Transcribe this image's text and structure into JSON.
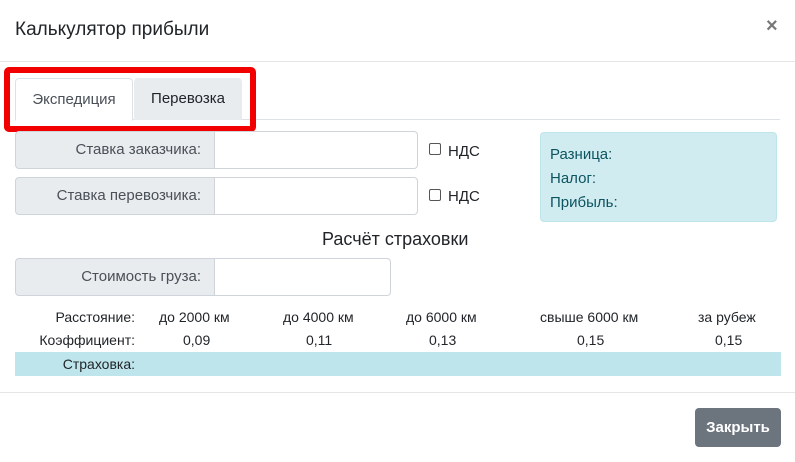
{
  "header": {
    "title": "Калькулятор прибыли",
    "close_icon": "×"
  },
  "tabs": [
    {
      "label": "Экспедиция",
      "active": true
    },
    {
      "label": "Перевозка",
      "active": false
    }
  ],
  "form": {
    "customer_rate_label": "Ставка заказчика:",
    "customer_rate_value": "",
    "carrier_rate_label": "Ставка перевозчика:",
    "carrier_rate_value": "",
    "vat_label": "НДС",
    "vat_customer_checked": false,
    "vat_carrier_checked": false,
    "cargo_value_label": "Стоимость груза:",
    "cargo_value_value": ""
  },
  "results": {
    "difference": "Разница:",
    "tax": "Налог:",
    "profit": "Прибыль:"
  },
  "insurance": {
    "title": "Расчёт страховки",
    "distance_label": "Расстояние:",
    "coef_label": "Коэффициент:",
    "insurance_label": "Страховка:",
    "distances": [
      "до 2000 км",
      "до 4000 км",
      "до 6000 км",
      "свыше 6000 км",
      "за рубеж"
    ],
    "coefficients": [
      "0,09",
      "0,11",
      "0,13",
      "0,15",
      "0,15"
    ]
  },
  "footer": {
    "close_button": "Закрыть"
  },
  "colors": {
    "highlight": "#f20000",
    "info_bg": "#d1ecf1",
    "button": "#6c757d"
  }
}
